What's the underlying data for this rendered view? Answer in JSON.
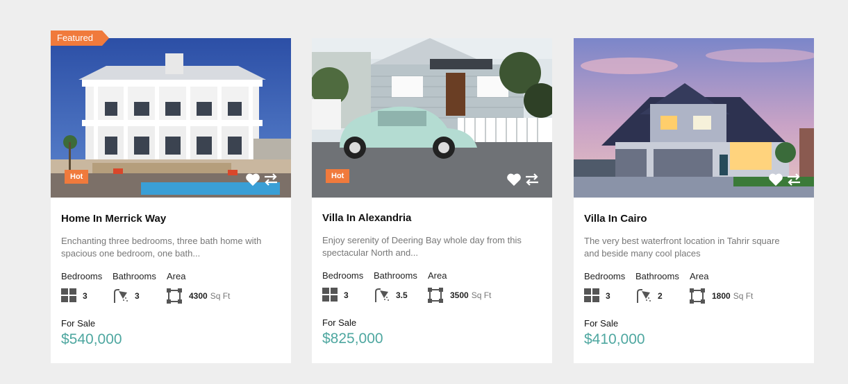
{
  "badges": {
    "featured": "Featured",
    "hot": "Hot"
  },
  "labels": {
    "bedrooms": "Bedrooms",
    "bathrooms": "Bathrooms",
    "area": "Area",
    "unit": "Sq Ft"
  },
  "listings": [
    {
      "title": "Home In Merrick Way",
      "description": "Enchanting three bedrooms, three bath home with spacious one bedroom, one bath...",
      "bedrooms": "3",
      "bathrooms": "3",
      "area": "4300",
      "status": "For Sale",
      "price": "$540,000",
      "featured": true,
      "hot": true
    },
    {
      "title": "Villa In Alexandria",
      "description": "Enjoy serenity of Deering Bay whole day from this spectacular North and...",
      "bedrooms": "3",
      "bathrooms": "3.5",
      "area": "3500",
      "status": "For Sale",
      "price": "$825,000",
      "featured": false,
      "hot": true
    },
    {
      "title": "Villa In Cairo",
      "description": "The very best waterfront location in Tahrir square and beside many cool places",
      "bedrooms": "3",
      "bathrooms": "2",
      "area": "1800",
      "status": "For Sale",
      "price": "$410,000",
      "featured": false,
      "hot": false
    }
  ],
  "icons": {
    "favorite": "heart-icon",
    "compare": "compare-arrows-icon",
    "bedrooms": "bed-grid-icon",
    "bathrooms": "shower-icon",
    "area": "area-square-icon"
  },
  "colors": {
    "accent": "#f07a3c",
    "price": "#4ea7a0",
    "background": "#eeeeee"
  }
}
